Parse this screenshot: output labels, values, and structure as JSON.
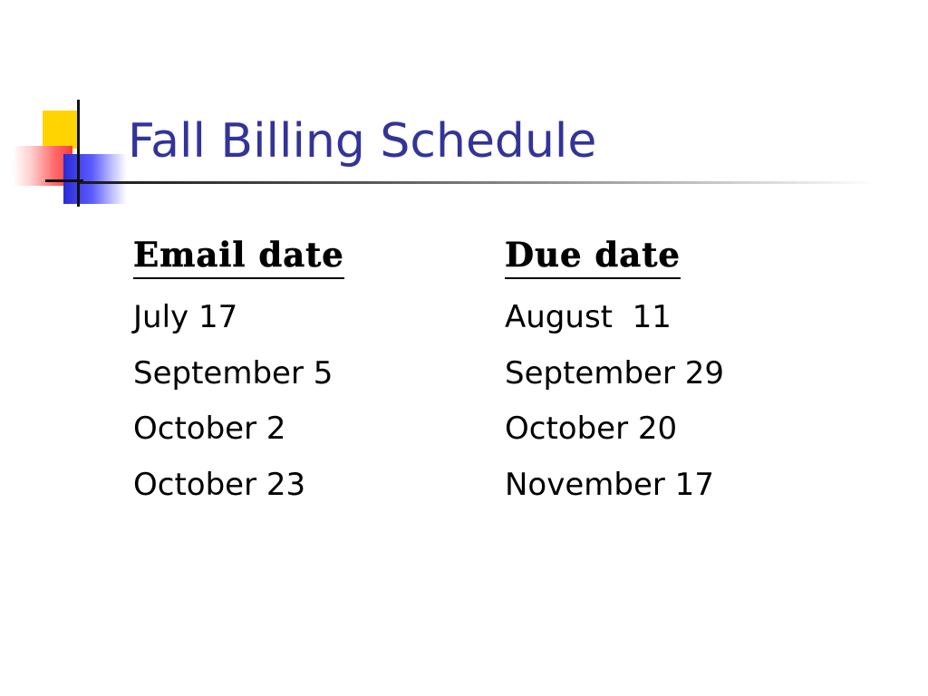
{
  "slide": {
    "title": "Fall Billing Schedule",
    "columns": [
      {
        "header": "Email date",
        "rows": [
          "July 17",
          "September 5",
          "October 2",
          "October 23"
        ]
      },
      {
        "header": "Due date",
        "rows": [
          "August  11",
          "September 29",
          "October 20",
          "November 17"
        ]
      }
    ]
  },
  "colors": {
    "title": "#333399",
    "text": "#000000",
    "accent_yellow": "#ffd400",
    "accent_red": "#ff3b3b",
    "accent_blue": "#2a2ad6"
  }
}
